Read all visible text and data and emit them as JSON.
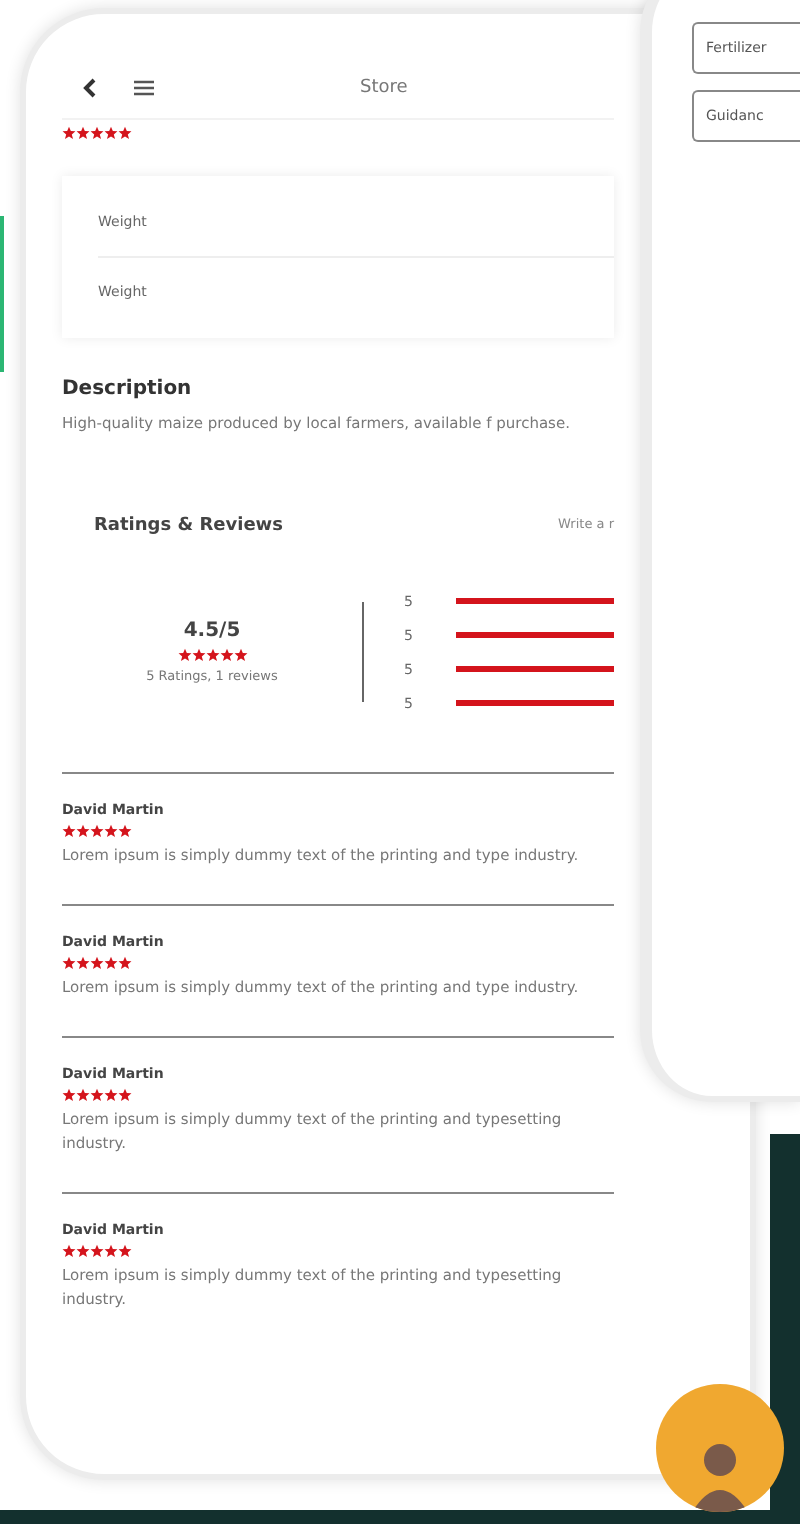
{
  "store_screen": {
    "title": "Store",
    "stars": 5,
    "specs": [
      "Weight",
      "Weight"
    ],
    "description": {
      "heading": "Description",
      "text": "High-quality maize produced by local farmers, available f purchase."
    },
    "ratings": {
      "heading": "Ratings & Reviews",
      "write_link": "Write a r",
      "score": "4.5/5",
      "stars": 5,
      "summary": "5 Ratings, 1 reviews",
      "bars": [
        {
          "label": "5",
          "level": 1
        },
        {
          "label": "5",
          "level": 1
        },
        {
          "label": "5",
          "level": 1
        },
        {
          "label": "5",
          "level": 1
        }
      ]
    },
    "reviews": [
      {
        "name": "David Martin",
        "stars": 5,
        "text": "Lorem ipsum is simply dummy text of the printing and type industry."
      },
      {
        "name": "David Martin",
        "stars": 5,
        "text": "Lorem ipsum is simply dummy text of the printing and type industry."
      },
      {
        "name": "David Martin",
        "stars": 5,
        "text": "Lorem ipsum is simply dummy text of the printing and typesetting industry."
      },
      {
        "name": "David Martin",
        "stars": 5,
        "text": "Lorem ipsum is simply dummy text of the printing and typesetting industry."
      }
    ]
  },
  "side_screen": {
    "buttons": [
      "Fertilizer",
      "Guidanc"
    ]
  }
}
